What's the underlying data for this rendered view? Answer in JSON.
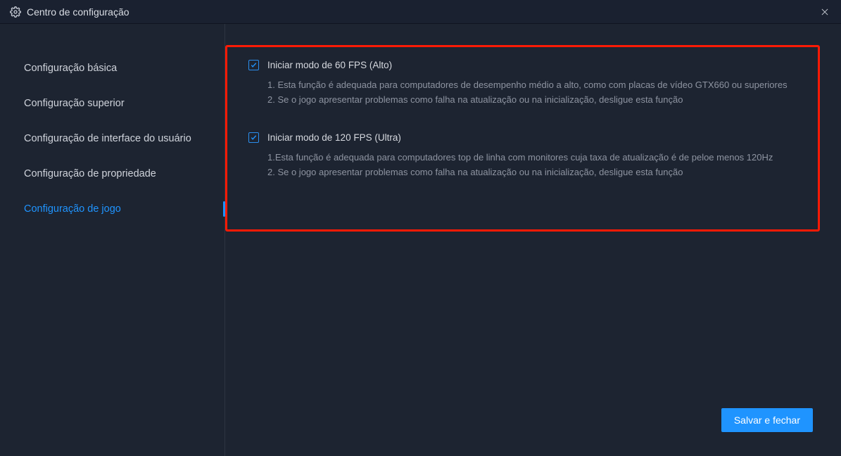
{
  "header": {
    "title": "Centro de configuração"
  },
  "sidebar": {
    "items": [
      {
        "label": "Configuração básica"
      },
      {
        "label": "Configuração superior"
      },
      {
        "label": "Configuração de interface do usuário"
      },
      {
        "label": "Configuração de propriedade"
      },
      {
        "label": "Configuração de jogo"
      }
    ],
    "active_index": 4
  },
  "settings": {
    "fps60": {
      "checked": true,
      "title": "Iniciar modo de 60 FPS (Alto)",
      "line1": "1. Esta função é adequada para computadores de desempenho médio a alto, como com placas de vídeo GTX660 ou superiores",
      "line2": "2. Se o jogo apresentar problemas como falha na atualização ou na inicialização, desligue esta função"
    },
    "fps120": {
      "checked": true,
      "title": "Iniciar modo de 120 FPS (Ultra)",
      "line1": "1.Esta função é adequada para computadores top de linha com monitores cuja taxa de atualização é de peloe menos 120Hz",
      "line2": "2. Se o jogo apresentar problemas como falha na atualização ou na inicialização, desligue esta função"
    }
  },
  "footer": {
    "save_label": "Salvar e fechar"
  },
  "colors": {
    "accent": "#1f94ff",
    "highlight": "#ff1a05",
    "bg": "#1d2431"
  }
}
